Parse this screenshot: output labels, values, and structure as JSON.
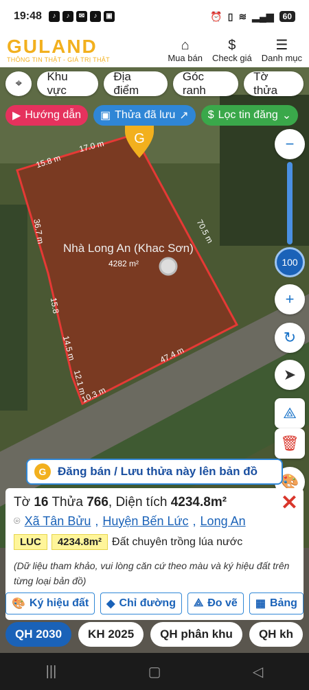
{
  "status_bar": {
    "time": "19:48",
    "battery": "60"
  },
  "header": {
    "logo": "GULAND",
    "tagline": "THÔNG TIN THẬT - GIÁ TRỊ THẬT",
    "nav": [
      {
        "label": "Mua bán",
        "icon": "building-icon"
      },
      {
        "label": "Check giá",
        "icon": "dollar-icon"
      },
      {
        "label": "Danh mục",
        "icon": "menu-icon"
      }
    ]
  },
  "chips": [
    "Khu vực",
    "Địa điểm",
    "Góc ranh",
    "Tờ thửa"
  ],
  "tools": {
    "guide": "Hướng dẫn",
    "saved": "Thửa đã lưu",
    "filter": "Lọc tin đăng"
  },
  "map": {
    "parcel_name": "Nhà Long An (Khac Sơn)",
    "parcel_area_label": "4282 m²",
    "edges": [
      "17.0 m",
      "15.8 m",
      "36.7 m",
      "70.5 m",
      "15.8",
      "14.5 m",
      "12.1 m",
      "10.3 m",
      "47.4 m"
    ],
    "zoom": "100"
  },
  "banner": {
    "text": "Đăng bán / Lưu thửa này lên bản đồ"
  },
  "panel": {
    "title_prefix": "Tờ",
    "sheet": "16",
    "plot_prefix": "Thửa",
    "plot": "766",
    "area_prefix": "Diện tích",
    "area": "4234.8m²",
    "commune": "Xã Tân Bửu",
    "district": "Huyện Bến Lức",
    "province": "Long An",
    "land_code": "LUC",
    "land_area": "4234.8m²",
    "land_type": "Đất chuyên trồng lúa nước",
    "note": "(Dữ liệu tham khảo, vui lòng căn cứ theo màu và ký hiệu đất trên từng loại bản đồ)"
  },
  "actions": [
    "Ký hiệu đất",
    "Chỉ đường",
    "Đo vẽ",
    "Bảng"
  ],
  "plans": [
    {
      "label": "QH 2030",
      "active": true
    },
    {
      "label": "KH 2025",
      "active": false
    },
    {
      "label": "QH phân khu",
      "active": false
    },
    {
      "label": "QH kh",
      "active": false
    }
  ]
}
